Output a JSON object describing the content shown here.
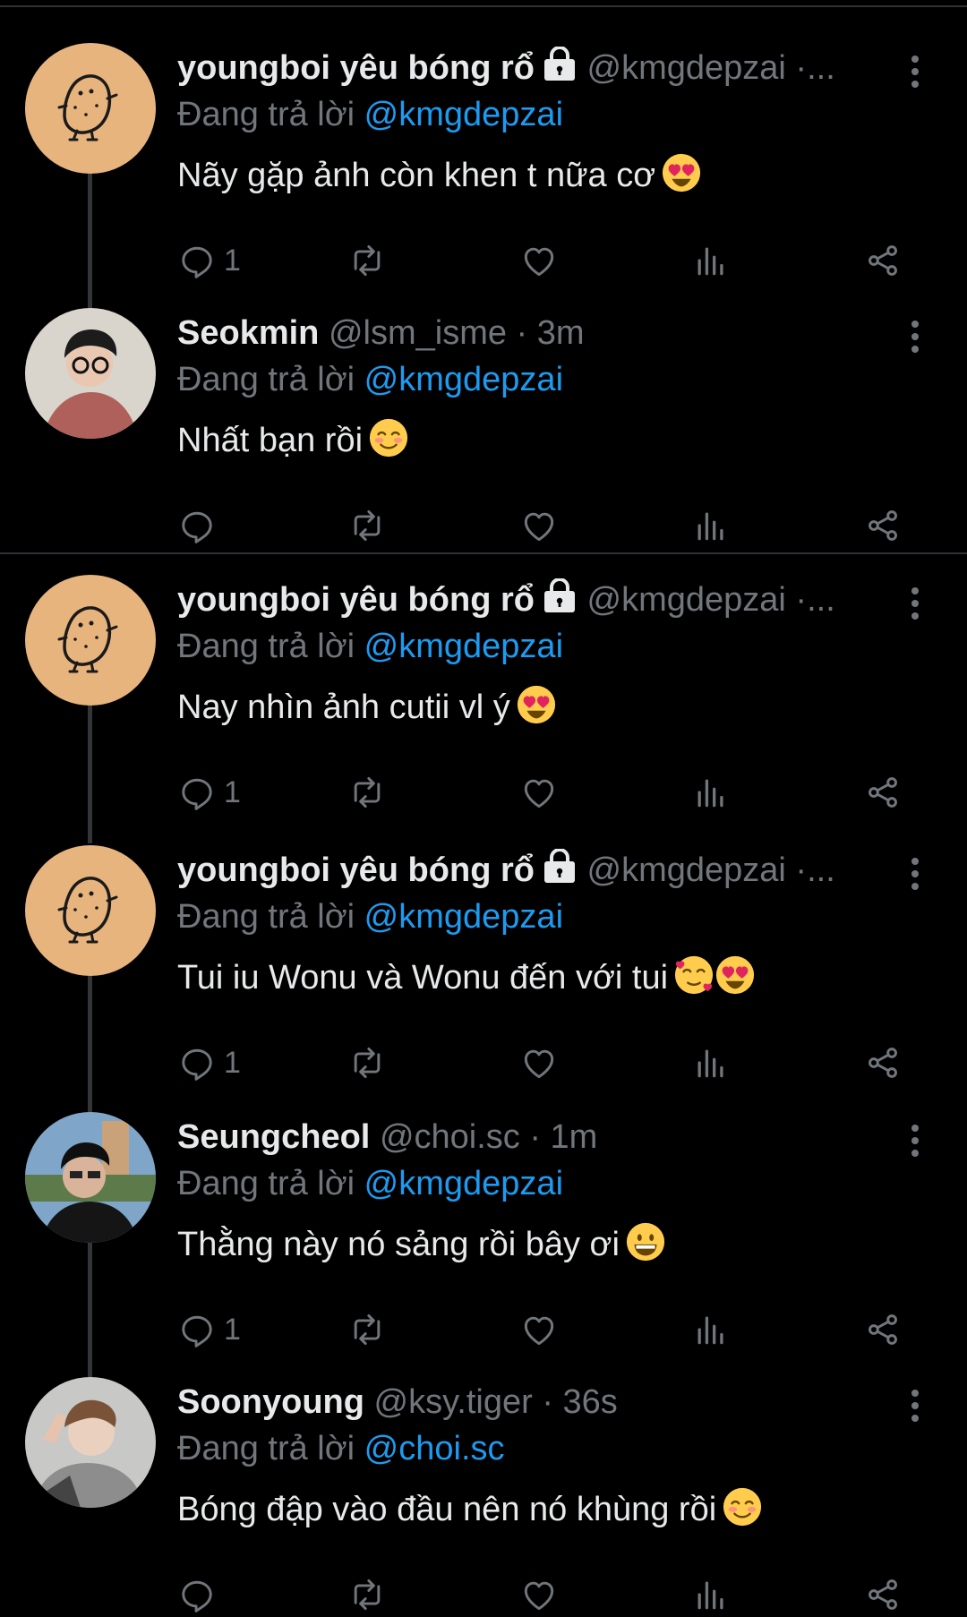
{
  "tweets": [
    {
      "name": "youngboi yêu bóng rổ",
      "meta": "@kmgdepzai ·...",
      "reply_prefix": "Đang trả lời",
      "reply_to": "@kmgdepzai",
      "text": "Nãy gặp ảnh còn khen t nữa cơ",
      "reply_count": "1"
    },
    {
      "name": "Seokmin",
      "meta": "@lsm_isme · 3m",
      "reply_prefix": "Đang trả lời",
      "reply_to": "@kmgdepzai",
      "text": "Nhất bạn rồi",
      "reply_count": ""
    },
    {
      "name": "youngboi yêu bóng rổ",
      "meta": "@kmgdepzai ·...",
      "reply_prefix": "Đang trả lời",
      "reply_to": "@kmgdepzai",
      "text": "Nay nhìn ảnh cutii vl ý",
      "reply_count": "1"
    },
    {
      "name": "youngboi yêu bóng rổ",
      "meta": "@kmgdepzai ·...",
      "reply_prefix": "Đang trả lời",
      "reply_to": "@kmgdepzai",
      "text": "Tui iu Wonu và Wonu đến với tui",
      "reply_count": "1"
    },
    {
      "name": "Seungcheol",
      "meta": "@choi.sc · 1m",
      "reply_prefix": "Đang trả lời",
      "reply_to": "@kmgdepzai",
      "text": "Thằng này nó sảng rồi bây ơi",
      "reply_count": "1"
    },
    {
      "name": "Soonyoung",
      "meta": "@ksy.tiger · 36s",
      "reply_prefix": "Đang trả lời",
      "reply_to": "@choi.sc",
      "text": "Bóng đập vào đầu nên nó khùng rồi",
      "reply_count": ""
    }
  ],
  "colors": {
    "background": "#000000",
    "text": "#e7e9ea",
    "muted": "#71767b",
    "mention": "#1d9bf0",
    "avatar_bg": "#e8b47e"
  }
}
